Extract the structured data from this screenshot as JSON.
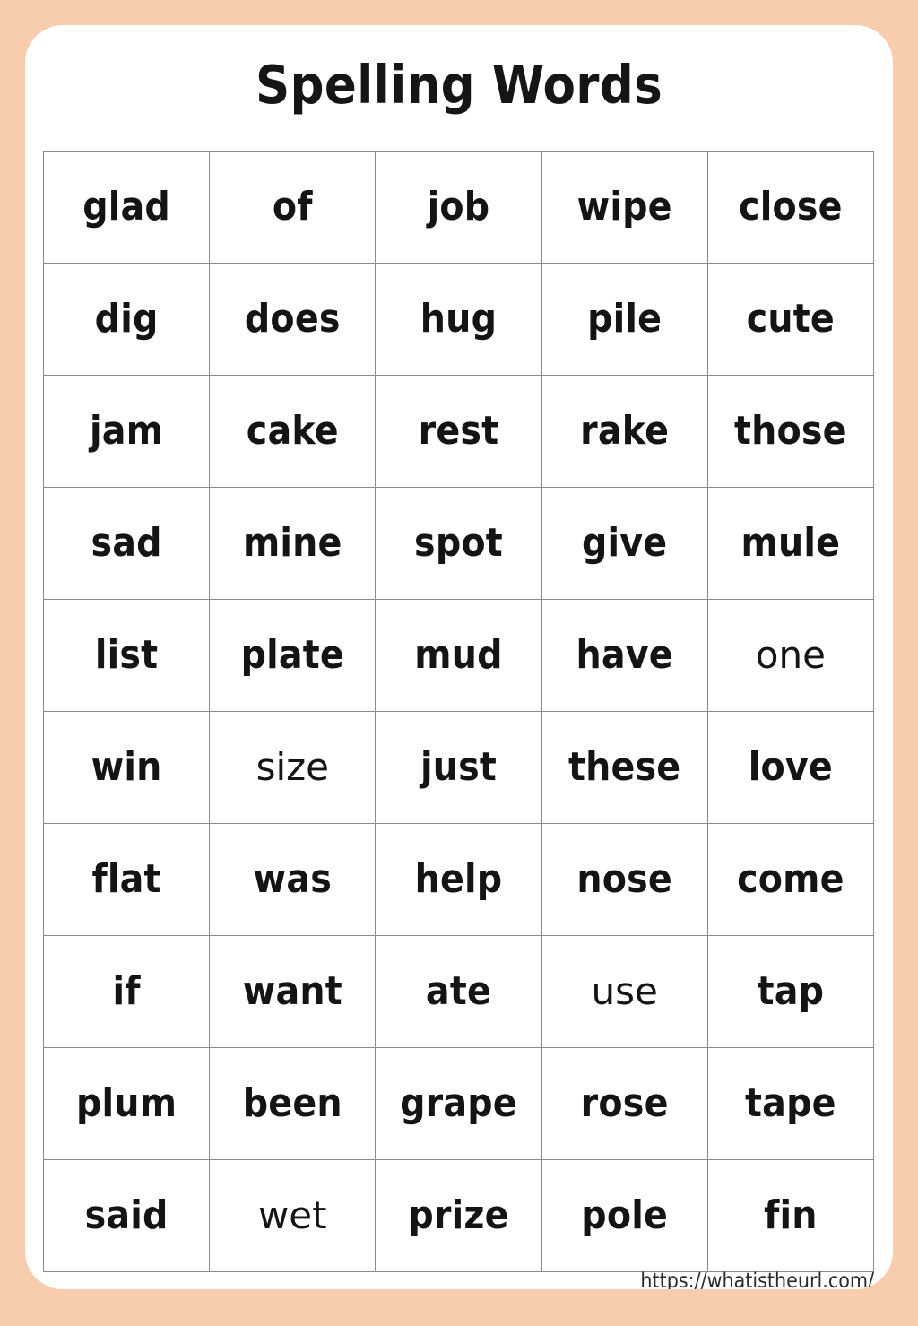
{
  "document": {
    "title": "Spelling Words",
    "background_color": "#f8cdae",
    "sheet_color": "#ffffff",
    "grid_line_color": "#8a8a8a",
    "text_color": "#141414"
  },
  "table": {
    "columns": 5,
    "rows_count": 10,
    "rows": [
      [
        "glad",
        "of",
        "job",
        "wipe",
        "close"
      ],
      [
        "dig",
        "does",
        "hug",
        "pile",
        "cute"
      ],
      [
        "jam",
        "cake",
        "rest",
        "rake",
        "those"
      ],
      [
        "sad",
        "mine",
        "spot",
        "give",
        "mule"
      ],
      [
        "list",
        "plate",
        "mud",
        "have",
        "one"
      ],
      [
        "win",
        "size",
        "just",
        "these",
        "love"
      ],
      [
        "flat",
        "was",
        "help",
        "nose",
        "come"
      ],
      [
        "if",
        "want",
        "ate",
        "use",
        "tap"
      ],
      [
        "plum",
        "been",
        "grape",
        "rose",
        "tape"
      ],
      [
        "said",
        "wet",
        "prize",
        "pole",
        "fin"
      ]
    ]
  },
  "footer": {
    "link_text": "https://whatistheurl.com/"
  }
}
